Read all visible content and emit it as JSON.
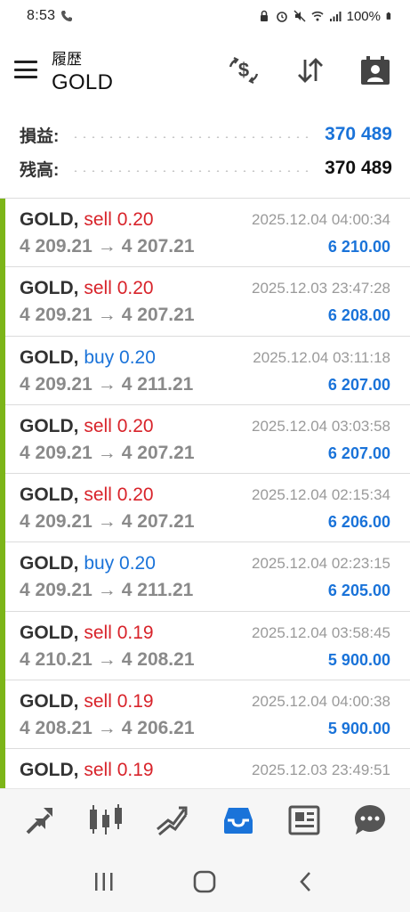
{
  "status_bar": {
    "time": "8:53",
    "battery": "100%"
  },
  "header": {
    "subtitle": "履歴",
    "title": "GOLD"
  },
  "summary": {
    "profit_label": "損益:",
    "profit_value": "370 489",
    "balance_label": "残高:",
    "balance_value": "370 489"
  },
  "deals": [
    {
      "symbol": "GOLD,",
      "side": "sell",
      "volume": "0.20",
      "open_price": "4 209.21",
      "close_price": "4 207.21",
      "time": "2025.12.04 04:00:34",
      "profit": "6 210.00"
    },
    {
      "symbol": "GOLD,",
      "side": "sell",
      "volume": "0.20",
      "open_price": "4 209.21",
      "close_price": "4 207.21",
      "time": "2025.12.03 23:47:28",
      "profit": "6 208.00"
    },
    {
      "symbol": "GOLD,",
      "side": "buy",
      "volume": "0.20",
      "open_price": "4 209.21",
      "close_price": "4 211.21",
      "time": "2025.12.04 03:11:18",
      "profit": "6 207.00"
    },
    {
      "symbol": "GOLD,",
      "side": "sell",
      "volume": "0.20",
      "open_price": "4 209.21",
      "close_price": "4 207.21",
      "time": "2025.12.04 03:03:58",
      "profit": "6 207.00"
    },
    {
      "symbol": "GOLD,",
      "side": "sell",
      "volume": "0.20",
      "open_price": "4 209.21",
      "close_price": "4 207.21",
      "time": "2025.12.04 02:15:34",
      "profit": "6 206.00"
    },
    {
      "symbol": "GOLD,",
      "side": "buy",
      "volume": "0.20",
      "open_price": "4 209.21",
      "close_price": "4 211.21",
      "time": "2025.12.04 02:23:15",
      "profit": "6 205.00"
    },
    {
      "symbol": "GOLD,",
      "side": "sell",
      "volume": "0.19",
      "open_price": "4 210.21",
      "close_price": "4 208.21",
      "time": "2025.12.04 03:58:45",
      "profit": "5 900.00"
    },
    {
      "symbol": "GOLD,",
      "side": "sell",
      "volume": "0.19",
      "open_price": "4 208.21",
      "close_price": "4 206.21",
      "time": "2025.12.04 04:00:38",
      "profit": "5 900.00"
    },
    {
      "symbol": "GOLD,",
      "side": "sell",
      "volume": "0.19",
      "open_price": "",
      "close_price": "",
      "time": "2025.12.03 23:49:51",
      "profit": ""
    }
  ],
  "bottom_nav": [
    "quotes",
    "chart",
    "trade",
    "history",
    "news",
    "chat"
  ],
  "active_nav": "history",
  "colors": {
    "accent_blue": "#1a73d9",
    "sell_red": "#d8232a",
    "position_bar_green": "#7cb518",
    "icon_gray": "#555555"
  },
  "icons": {
    "header": [
      "currency-exchange-icon",
      "sort-icon",
      "calendar-icon"
    ],
    "status_bar": [
      "wifi-icon",
      "signal-icon",
      "battery-icon",
      "alarm-icon",
      "mute-icon"
    ]
  }
}
